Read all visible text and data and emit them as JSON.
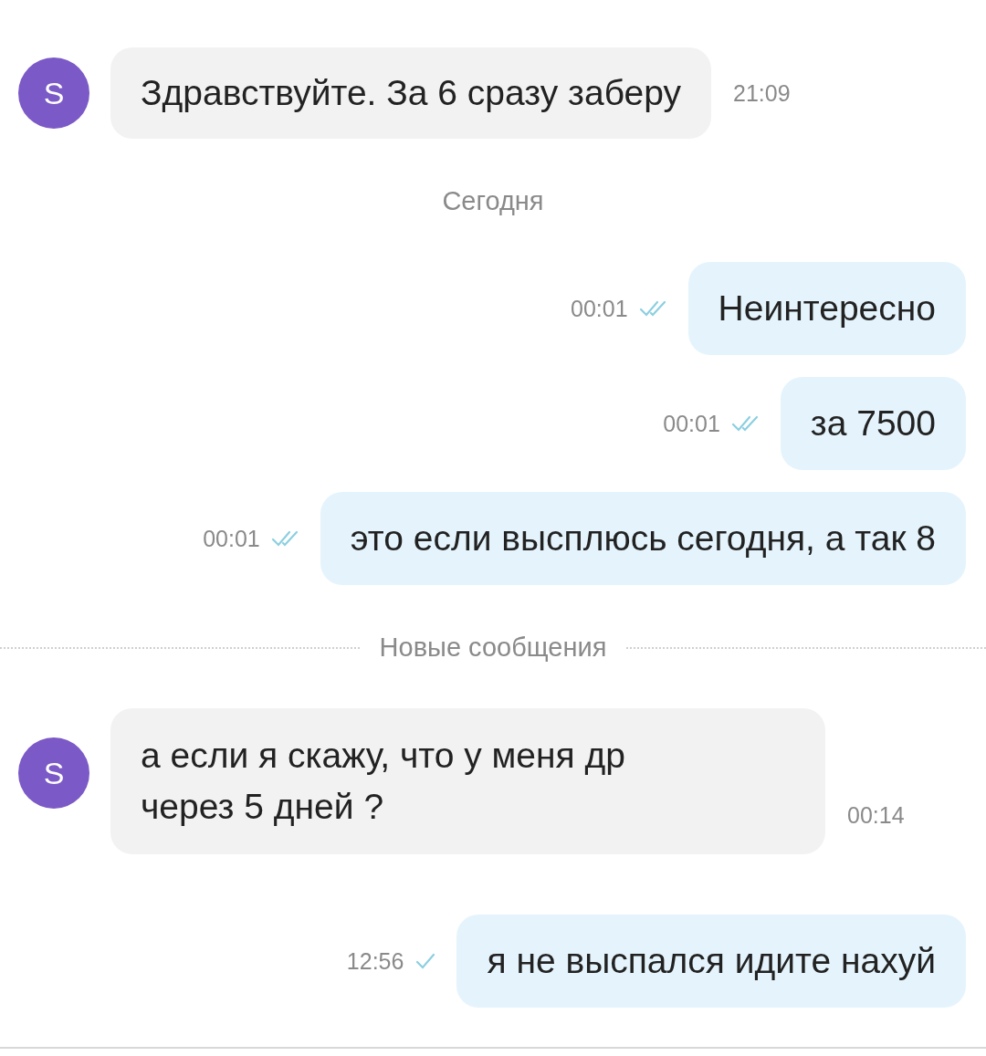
{
  "items": [
    {
      "kind": "incoming",
      "avatar": "S",
      "text": "Здравствуйте. За 6 сразу заберу",
      "time": "21:09"
    },
    {
      "kind": "date",
      "text": "Сегодня"
    },
    {
      "kind": "outgoing",
      "text": "Неинтересно",
      "time": "00:01",
      "read": true
    },
    {
      "kind": "outgoing",
      "text": "за 7500",
      "time": "00:01",
      "read": true
    },
    {
      "kind": "outgoing",
      "text": "это если высплюсь сегодня, а так 8",
      "time": "00:01",
      "read": true
    },
    {
      "kind": "new",
      "text": "Новые сообщения"
    },
    {
      "kind": "incoming",
      "avatar": "S",
      "text": "а если я скажу, что у меня др через 5 дней ?",
      "time": "00:14",
      "wide": true
    },
    {
      "kind": "outgoing",
      "text": "я не выспался идите нахуй",
      "time": "12:56",
      "read": false
    }
  ]
}
